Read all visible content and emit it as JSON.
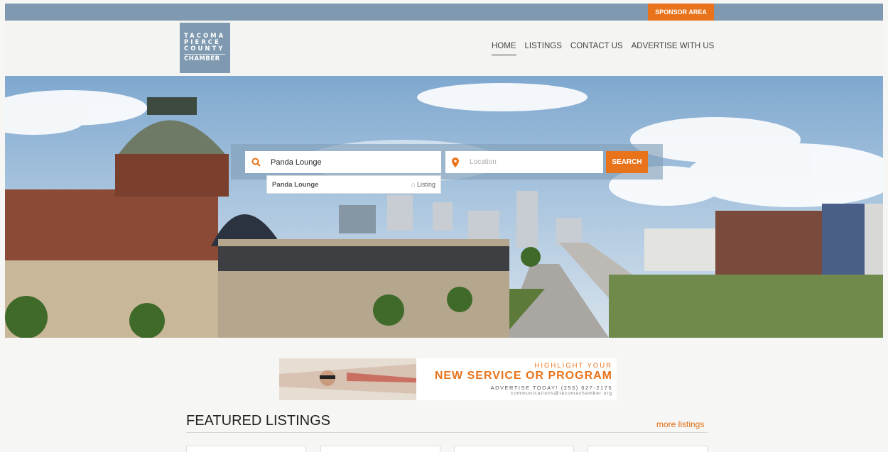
{
  "topbar": {
    "sponsor_label": "SPONSOR AREA"
  },
  "logo": {
    "lines": [
      "TACOMA",
      "PIERCE",
      "COUNTY",
      "CHAMBER"
    ]
  },
  "nav": {
    "items": [
      {
        "label": "HOME",
        "active": true
      },
      {
        "label": "LISTINGS",
        "active": false
      },
      {
        "label": "CONTACT US",
        "active": false
      },
      {
        "label": "ADVERTISE WITH US",
        "active": false
      }
    ]
  },
  "search": {
    "query_value": "Panda Lounge",
    "location_placeholder": "Location",
    "button_label": "SEARCH",
    "suggestion": {
      "name": "Panda Lounge",
      "type": "Listing"
    }
  },
  "ad": {
    "line1": "HIGHLIGHT YOUR",
    "line2": "NEW SERVICE OR PROGRAM",
    "line3": "ADVERTISE TODAY! (253) 627-2175",
    "line4": "communications@tacomachamber.org"
  },
  "featured": {
    "title": "FEATURED LISTINGS",
    "more_label": "more listings"
  },
  "colors": {
    "accent": "#e8731a",
    "brand_blue": "#7f9ab0"
  },
  "icons": {
    "search": "search-icon",
    "location": "map-pin-icon",
    "listing": "home-icon"
  }
}
